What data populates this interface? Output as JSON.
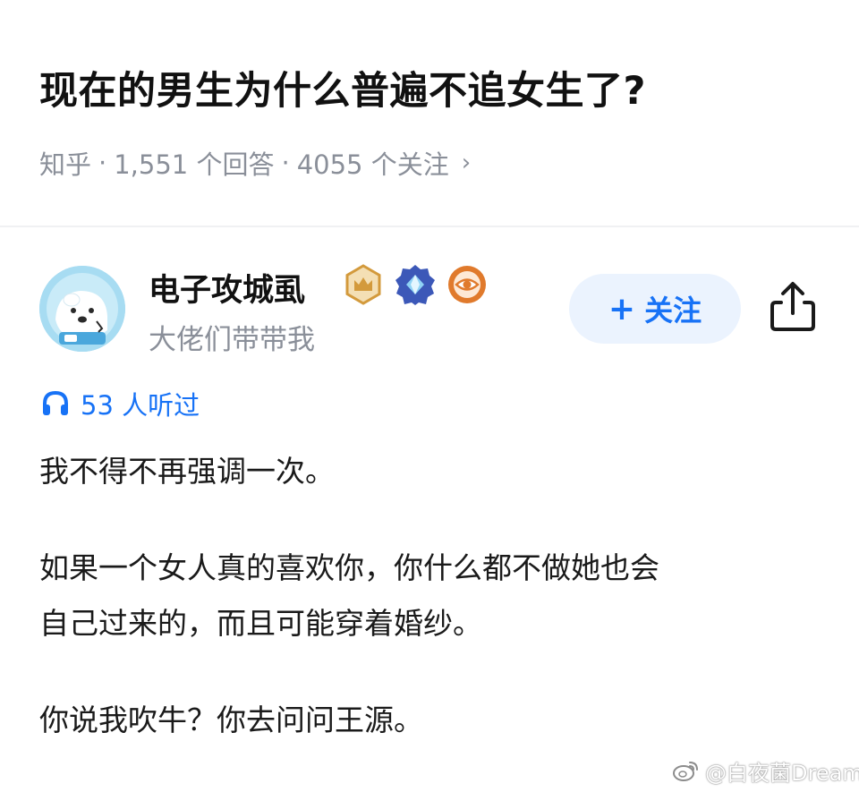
{
  "question": {
    "title": "现在的男生为什么普遍不追女生了?",
    "source": "知乎",
    "sep": "·",
    "answers_count": "1,551 个回答",
    "followers_count": "4055 个关注",
    "chevron": "›"
  },
  "author": {
    "name": "电子攻城虱",
    "bio": "大佬们带带我",
    "badges": [
      "crown-badge",
      "diamond-badge",
      "eye-badge"
    ]
  },
  "actions": {
    "follow_plus": "+",
    "follow_label": "关注",
    "share_icon": "share-icon"
  },
  "listen": {
    "icon": "headphones-icon",
    "text": "53 人听过"
  },
  "answer": {
    "p1": "我不得不再强调一次。",
    "p2_line1": "如果一个女人真的喜欢你，你什么都不做她也会",
    "p2_line2": "自己过来的，而且可能穿着婚纱。",
    "p3": "你说我吹牛？你去问问王源。"
  },
  "watermark": {
    "text": "@白夜菌Dream",
    "icon": "weibo-icon"
  },
  "colors": {
    "accent": "#1772f6",
    "follow_bg": "#ebf3fe",
    "meta_gray": "#8a8f99",
    "gold": "#d39a3c",
    "diamond_blue": "#3c58b8",
    "orange": "#e07a2c"
  }
}
